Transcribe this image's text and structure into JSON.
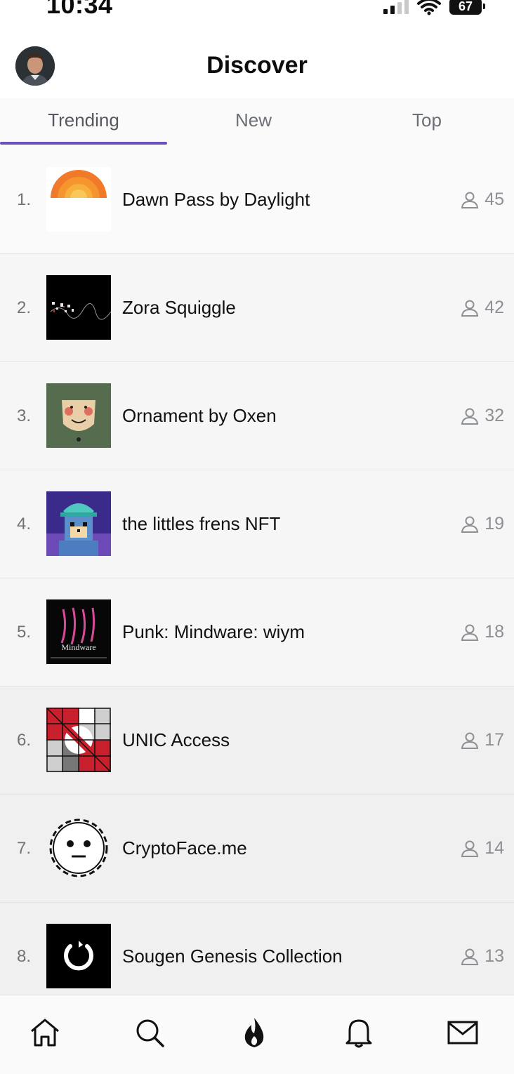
{
  "status_bar": {
    "time": "10:34",
    "battery": "67"
  },
  "header": {
    "title": "Discover",
    "avatar_icon": "user-avatar"
  },
  "tabs": [
    {
      "label": "Trending",
      "active": true
    },
    {
      "label": "New",
      "active": false
    },
    {
      "label": "Top",
      "active": false
    }
  ],
  "list": [
    {
      "rank": "1.",
      "name": "Dawn Pass by Daylight",
      "holders": "45"
    },
    {
      "rank": "2.",
      "name": "Zora Squiggle",
      "holders": "42"
    },
    {
      "rank": "3.",
      "name": "Ornament by Oxen",
      "holders": "32"
    },
    {
      "rank": "4.",
      "name": "the littles frens NFT",
      "holders": "19"
    },
    {
      "rank": "5.",
      "name": "Punk: Mindware: wiym",
      "holders": "18"
    },
    {
      "rank": "6.",
      "name": "UNIC Access",
      "holders": "17"
    },
    {
      "rank": "7.",
      "name": "CryptoFace.me",
      "holders": "14"
    },
    {
      "rank": "8.",
      "name": "Sougen Genesis Collection",
      "holders": "13"
    }
  ],
  "thumb_text": {
    "mindware": "Mindware"
  },
  "bottom_nav": [
    "home-icon",
    "search-icon",
    "flame-icon",
    "bell-icon",
    "mail-icon"
  ],
  "colors": {
    "accent": "#6b4fbb",
    "muted": "#8c8f94"
  }
}
